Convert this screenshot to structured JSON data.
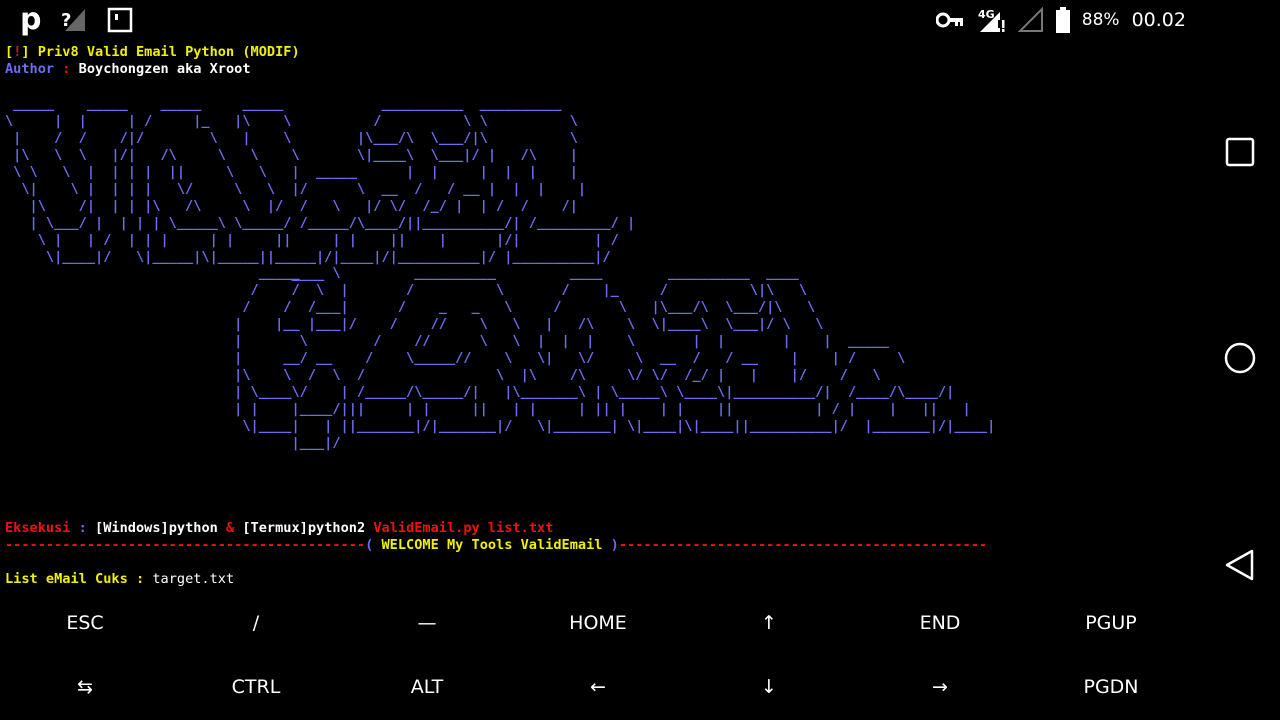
{
  "statusbar": {
    "app_letter": "p",
    "network_type": "4G",
    "battery": "88%",
    "time": "00.02",
    "icons": [
      "unknown-signal-icon",
      "notification-box-icon",
      "vpn-key-icon",
      "signal-4g-icon",
      "signal-empty-icon",
      "battery-icon"
    ]
  },
  "terminal": {
    "header": {
      "bracket_open": "[",
      "bang": "!",
      "bracket_close": "] ",
      "title": "Priv8 Valid Email Python (MODIF)",
      "author_label": "Author ",
      "author_colon": ": ",
      "author_name": "Boychongzen aka Xroot"
    },
    "banner_line1": " _____    _____    _____     _____            __________  __________\n\\     |  |     | /     |_   |\\    \\          /          \\ \\          \\\n |    /  /    /|/        \\   |    \\        |\\___/\\  \\___/|\\          \\\n |\\   \\  \\   |/|   /\\     \\   \\    \\       \\|____\\  \\___|/ |   /\\    |\n \\ \\   \\  |  | | |  ||     \\   \\   |  _____      |  |     |  |  |    |\n  \\|    \\ |  | | |   \\/     \\   \\  |/      \\  __  /   / __ |  |  |    |\n   |\\    /|  | | |\\   /\\     \\  |/  /   \\   |/ \\/  /_/ |  | /  /    /|\n   | \\___/ |  | | | \\_____\\ \\_____/ /_____/\\____/||__________/| /_________/ |\n    \\ |   | /  | | |     | |     ||     | |    ||    |      |/|         | /\n     \\|____|/   \\|_____|\\|_____||_____|/|____|/|__________|/ |__________|/\n                                   ____",
    "banner_line2": "                               _____    \\         __________         ____        __________  ____\n                              /    /  \\  |       /          \\       /    |_     /          \\|\\   \\\n                             /    /  /___|      /    _   _   \\     /       \\   |\\___/\\  \\___/|\\   \\\n                            |    |__ |___|/    /    //    \\   \\   |   /\\    \\  \\|____\\  \\___|/ \\   \\\n                            |       \\        /    //      \\   \\  |  |  |    \\       |  |       |    |  _____\n                            |     __/ __    /    \\_____//    \\   \\|   \\/     \\  __  /   / __    |    | /     \\\n                            |\\    \\  /  \\  /                \\  |\\    /\\     \\/ \\/  /_/ |   |    |/    /   \\\n                            | \\____\\/    | /_____/\\_____/|   |\\_______\\ | \\_____\\ \\____\\|__________/|  /____/\\____/|\n                            | |    |____/|||     | |     ||   | |     | || |    | |    ||          | / |    |   ||   |\n                             \\|____|   | ||_______|/|_______|/   \\|_______| \\|____|\\|____||__________|/  |_______|/|____|\n                                   |___|/",
    "exec": {
      "label": "Eksekusi ",
      "colon": ": ",
      "windows": "[Windows]python ",
      "amp": "& ",
      "termux": "[Termux]python2 ",
      "script": "ValidEmail.py list.txt"
    },
    "welcome": {
      "dashes_left": "--------------------------------------------",
      "paren_open": "( ",
      "text": "WELCOME My Tools ValidEmail ",
      "paren_close": ")",
      "dashes_right": "---------------------------------------------"
    },
    "list": {
      "label": "List eMail Cuks : ",
      "value": "target.txt"
    }
  },
  "extra_keys": {
    "row1": [
      "ESC",
      "/",
      "—",
      "HOME",
      "↑",
      "END",
      "PGUP"
    ],
    "row2": [
      "⇆",
      "CTRL",
      "ALT",
      "←",
      "↓",
      "→",
      "PGDN"
    ]
  },
  "colors": {
    "background": "#000000",
    "yellow": "#f0f000",
    "red": "#ee1111",
    "blue": "#6c6cf0",
    "white": "#ffffff"
  },
  "navbar": {
    "icons": [
      "recent-apps-icon",
      "home-icon",
      "back-icon"
    ]
  }
}
